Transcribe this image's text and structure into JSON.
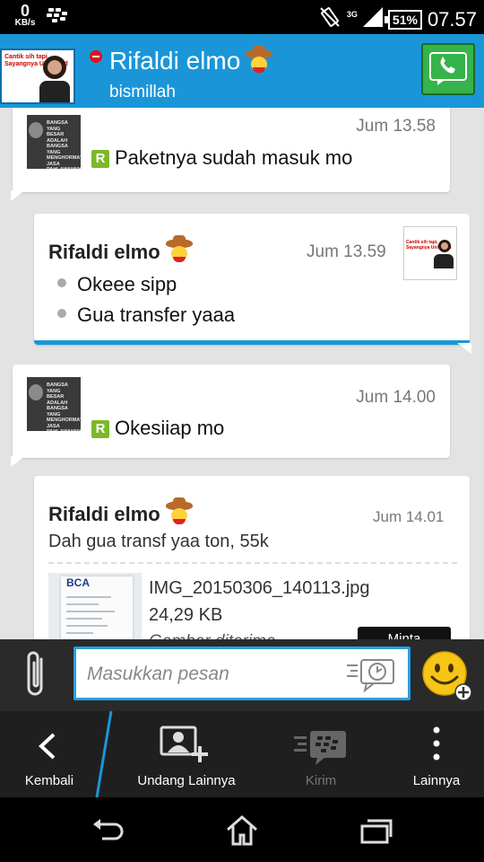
{
  "status_bar": {
    "speed_value": "0",
    "speed_unit": "KB/s",
    "network": "3G",
    "battery": "51%",
    "time": "07.57"
  },
  "header": {
    "contact_name": "Rifaldi elmo",
    "status_text": "bismillah",
    "avatar_caption": "Cantik sih tapi, Sayangnya Unlimited",
    "presence": "busy",
    "call_button_color": "#36b34a"
  },
  "messages": [
    {
      "direction": "incoming",
      "time": "Jum 13.58",
      "text": "Paketnya sudah masuk mo",
      "badge": "R"
    },
    {
      "direction": "outgoing",
      "sender": "Rifaldi elmo",
      "time": "Jum 13.59",
      "lines": [
        "Okeee sipp",
        "Gua transfer yaaa"
      ]
    },
    {
      "direction": "incoming",
      "time": "Jum 14.00",
      "text": "Okesiiap mo",
      "badge": "R"
    },
    {
      "direction": "outgoing",
      "sender": "Rifaldi elmo",
      "time": "Jum 14.01",
      "text": "Dah gua transf yaa ton, 55k",
      "file": {
        "name": "IMG_20150306_140113.jpg",
        "size": "24,29 KB",
        "status": "Gambar diterima",
        "bank_label": "BCA",
        "action": "Minta"
      }
    }
  ],
  "thumb_text": {
    "old_lines": "BANGSA YANG BESAR ADALAH BANGSA YANG MENGHORMATI JASA PAHLAWANNYA"
  },
  "compose": {
    "placeholder": "Masukkan pesan"
  },
  "action_bar": {
    "back": "Kembali",
    "invite": "Undang Lainnya",
    "send": "Kirim",
    "more": "Lainnya"
  },
  "colors": {
    "header_blue": "#1a96d8",
    "accent_green": "#7bb928"
  }
}
